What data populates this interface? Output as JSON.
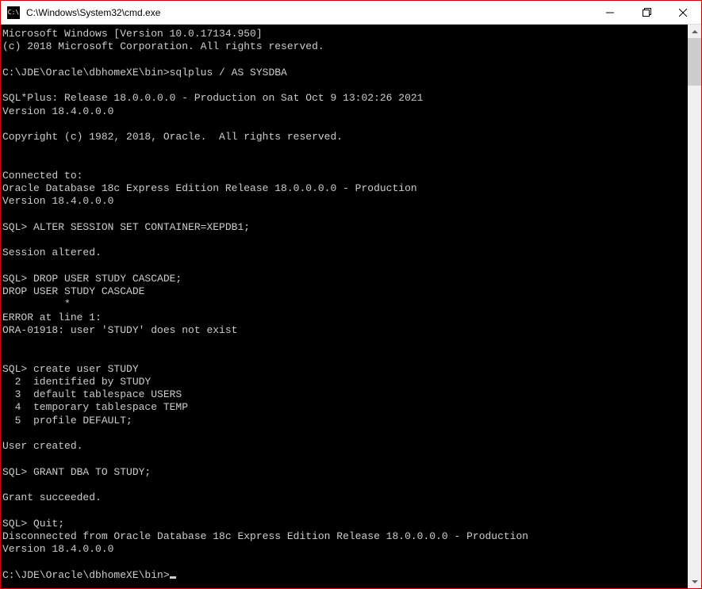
{
  "window": {
    "title_icon_text": "C:\\",
    "title": "C:\\Windows\\System32\\cmd.exe"
  },
  "terminal": {
    "lines": [
      "Microsoft Windows [Version 10.0.17134.950]",
      "(c) 2018 Microsoft Corporation. All rights reserved.",
      "",
      "C:\\JDE\\Oracle\\dbhomeXE\\bin>sqlplus / AS SYSDBA",
      "",
      "SQL*Plus: Release 18.0.0.0.0 - Production on Sat Oct 9 13:02:26 2021",
      "Version 18.4.0.0.0",
      "",
      "Copyright (c) 1982, 2018, Oracle.  All rights reserved.",
      "",
      "",
      "Connected to:",
      "Oracle Database 18c Express Edition Release 18.0.0.0.0 - Production",
      "Version 18.4.0.0.0",
      "",
      "SQL> ALTER SESSION SET CONTAINER=XEPDB1;",
      "",
      "Session altered.",
      "",
      "SQL> DROP USER STUDY CASCADE;",
      "DROP USER STUDY CASCADE",
      "          *",
      "ERROR at line 1:",
      "ORA-01918: user 'STUDY' does not exist",
      "",
      "",
      "SQL> create user STUDY",
      "  2  identified by STUDY",
      "  3  default tablespace USERS",
      "  4  temporary tablespace TEMP",
      "  5  profile DEFAULT;",
      "",
      "User created.",
      "",
      "SQL> GRANT DBA TO STUDY;",
      "",
      "Grant succeeded.",
      "",
      "SQL> Quit;",
      "Disconnected from Oracle Database 18c Express Edition Release 18.0.0.0.0 - Production",
      "Version 18.4.0.0.0",
      "",
      "C:\\JDE\\Oracle\\dbhomeXE\\bin>"
    ]
  }
}
